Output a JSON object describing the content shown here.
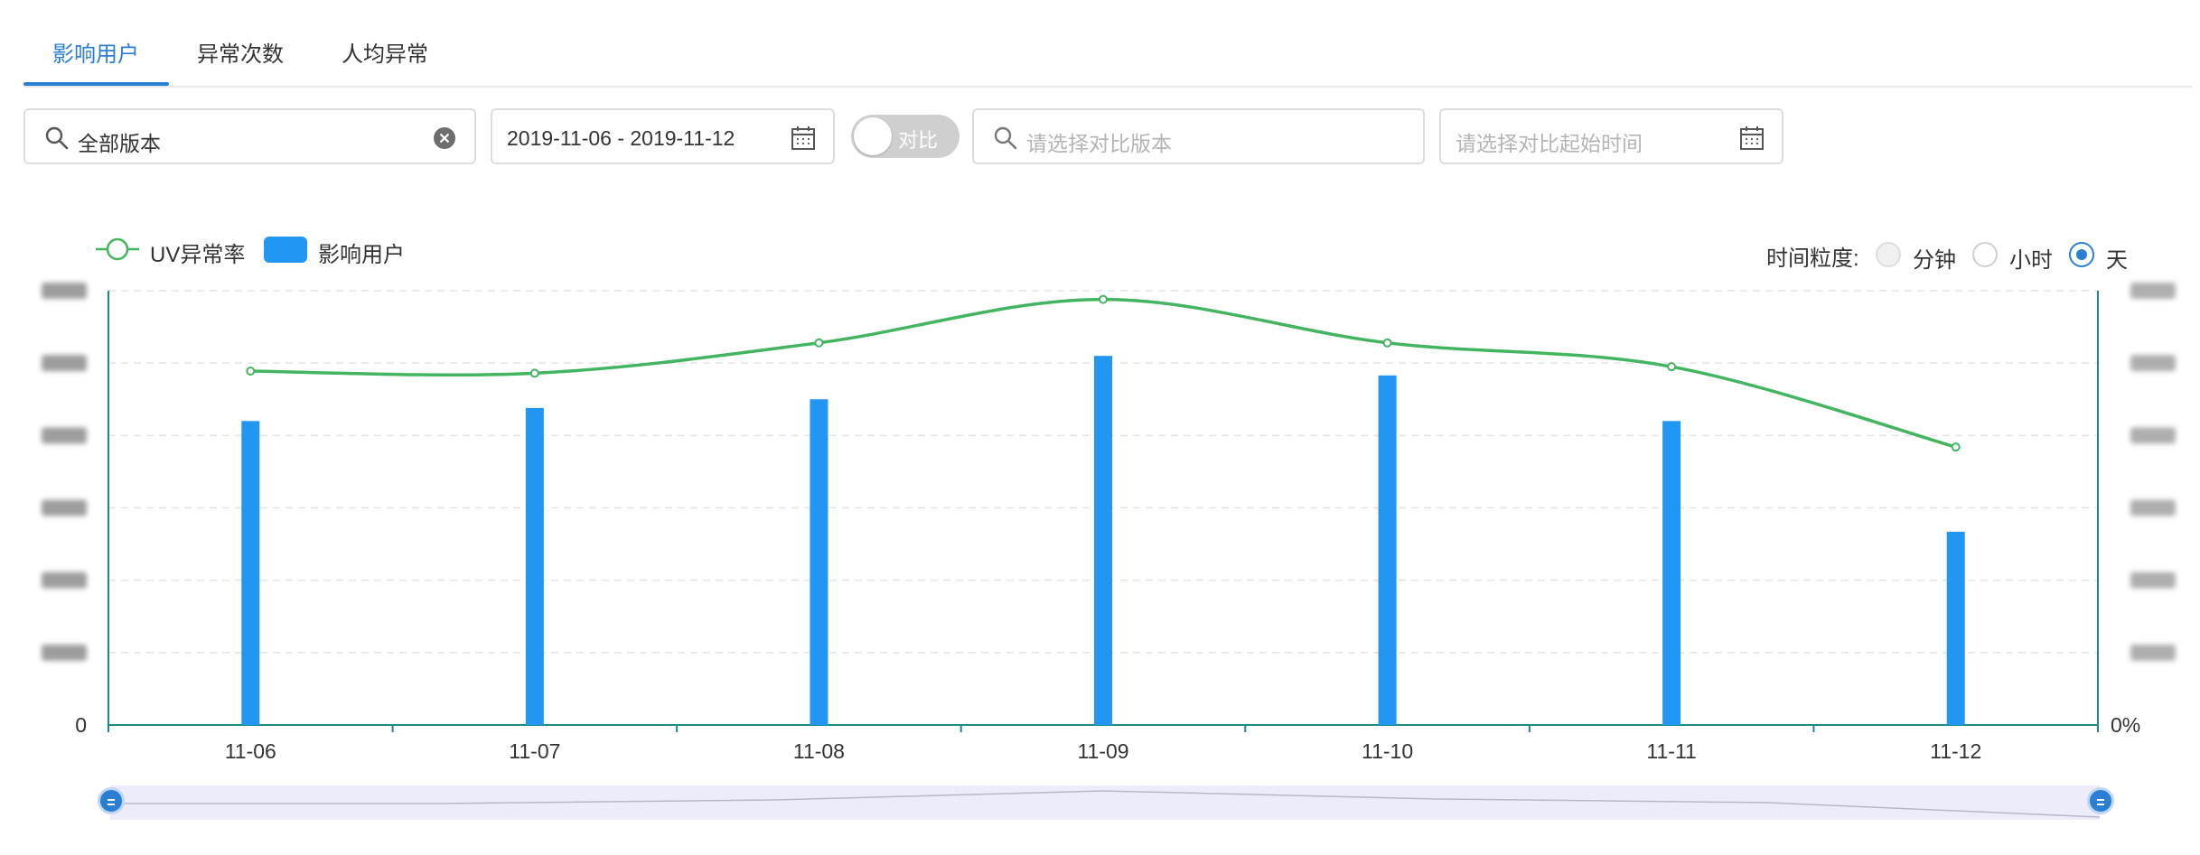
{
  "tabs": [
    {
      "label": "影响用户",
      "active": true
    },
    {
      "label": "异常次数",
      "active": false
    },
    {
      "label": "人均异常",
      "active": false
    }
  ],
  "filters": {
    "version_value": "全部版本",
    "date_range": "2019-11-06 - 2019-11-12",
    "compare_toggle_label": "对比",
    "compare_toggle_on": false,
    "compare_version_placeholder": "请选择对比版本",
    "compare_time_placeholder": "请选择对比起始时间"
  },
  "legend": {
    "line_label": "UV异常率",
    "bar_label": "影响用户"
  },
  "granularity": {
    "label": "时间粒度:",
    "options": [
      {
        "label": "分钟",
        "checked": false
      },
      {
        "label": "小时",
        "checked": false
      },
      {
        "label": "天",
        "checked": true
      }
    ]
  },
  "colors": {
    "accent": "#2a7fd3",
    "bar": "#2196f3",
    "line": "#43b561",
    "axis": "#1a8a8a"
  },
  "chart_data": {
    "type": "bar",
    "categories": [
      "11-06",
      "11-07",
      "11-08",
      "11-09",
      "11-10",
      "11-11",
      "11-12"
    ],
    "series": [
      {
        "name": "影响用户",
        "kind": "bar",
        "axis": "left",
        "values": [
          70,
          73,
          75,
          85,
          80.5,
          70,
          44.5
        ]
      },
      {
        "name": "UV异常率",
        "kind": "line",
        "axis": "right",
        "values": [
          81.5,
          81,
          88,
          98,
          88,
          82.5,
          64
        ]
      }
    ],
    "y_left": {
      "min": 0,
      "max": 100,
      "tick_labels": [
        "0"
      ]
    },
    "y_right": {
      "min": 0,
      "max": 100,
      "tick_labels": [
        "0%"
      ]
    },
    "grid": "horizontal-dashed",
    "legend_position": "top-left"
  }
}
